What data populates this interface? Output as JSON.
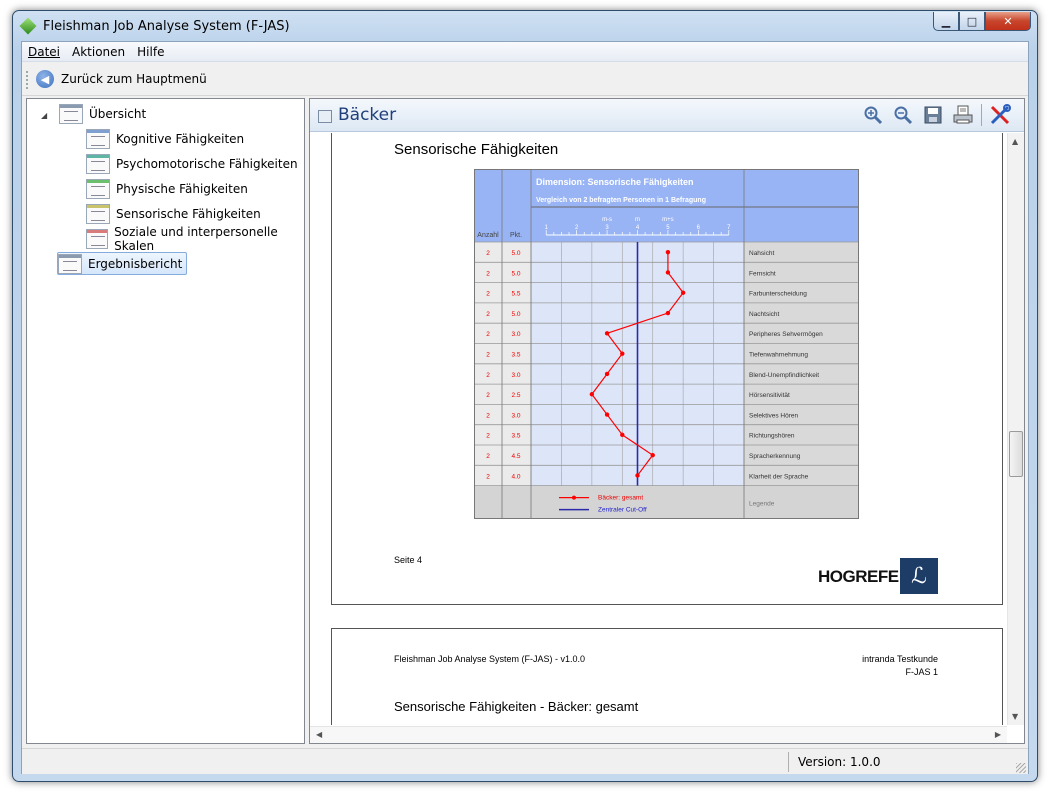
{
  "window": {
    "title": "Fleishman Job Analyse System (F-JAS)",
    "minimize": "▁",
    "maximize": "□",
    "close": "✕"
  },
  "menubar": [
    {
      "label": "Datei"
    },
    {
      "label": "Aktionen"
    },
    {
      "label": "Hilfe"
    }
  ],
  "toolbar": {
    "back_label": "Zurück zum Hauptmenü"
  },
  "tree": {
    "root": "Übersicht",
    "children": [
      "Kognitive Fähigkeiten",
      "Psychomotorische Fähigkeiten",
      "Physische Fähigkeiten",
      "Sensorische Fähigkeiten",
      "Soziale und interpersonelle Skalen"
    ],
    "report": "Ergebnisbericht"
  },
  "document": {
    "title": "Bäcker"
  },
  "page4": {
    "section_title": "Sensorische Fähigkeiten",
    "page_label": "Seite 4",
    "brand": "HOGREFE",
    "brand_mark": "ℒ"
  },
  "page5": {
    "system": "Fleishman Job Analyse System (F-JAS) - v1.0.0",
    "customer": "intranda Testkunde",
    "product": "F-JAS 1",
    "section_title": "Sensorische Fähigkeiten - Bäcker: gesamt"
  },
  "chart_data": {
    "type": "line",
    "title": "Dimension: Sensorische Fähigkeiten",
    "subtitle": "Vergleich von 2 befragten Personen in 1 Befragung",
    "columns": {
      "count": "Anzahl",
      "points": "Pkt."
    },
    "scale_labels": {
      "minus_s": "m-s",
      "mean": "m",
      "plus_s": "m+s"
    },
    "xlim": [
      1,
      7
    ],
    "ticks": [
      "1",
      "2",
      "3",
      "4",
      "5",
      "6",
      "7"
    ],
    "cutoff": 4.0,
    "mean": 4.0,
    "sd": 1.0,
    "rows": [
      {
        "count": "2",
        "points": "5.0",
        "label": "Nahsicht",
        "value": 5.0
      },
      {
        "count": "2",
        "points": "5.0",
        "label": "Fernsicht",
        "value": 5.0
      },
      {
        "count": "2",
        "points": "5.5",
        "label": "Farbunterscheidung",
        "value": 5.5
      },
      {
        "count": "2",
        "points": "5.0",
        "label": "Nachtsicht",
        "value": 5.0
      },
      {
        "count": "2",
        "points": "3.0",
        "label": "Peripheres Sehvermögen",
        "value": 3.0
      },
      {
        "count": "2",
        "points": "3.5",
        "label": "Tiefenwahrnehmung",
        "value": 3.5
      },
      {
        "count": "2",
        "points": "3.0",
        "label": "Blend-Unempfindlichkeit",
        "value": 3.0
      },
      {
        "count": "2",
        "points": "2.5",
        "label": "Hörsensitivität",
        "value": 2.5
      },
      {
        "count": "2",
        "points": "3.0",
        "label": "Selektives Hören",
        "value": 3.0
      },
      {
        "count": "2",
        "points": "3.5",
        "label": "Richtungshören",
        "value": 3.5
      },
      {
        "count": "2",
        "points": "4.5",
        "label": "Spracherkennung",
        "value": 4.5
      },
      {
        "count": "2",
        "points": "4.0",
        "label": "Klarheit der Sprache",
        "value": 4.0
      }
    ],
    "legend": {
      "series": "Bäcker: gesamt",
      "cutoff": "Zentraler Cut-Off",
      "title": "Legende"
    },
    "colors": {
      "series": "#ff0000",
      "cutoff": "#2a2aa8",
      "header": "#99b4f5",
      "row_bg": "#dde6f9"
    }
  },
  "status": {
    "version": "Version: 1.0.0"
  }
}
